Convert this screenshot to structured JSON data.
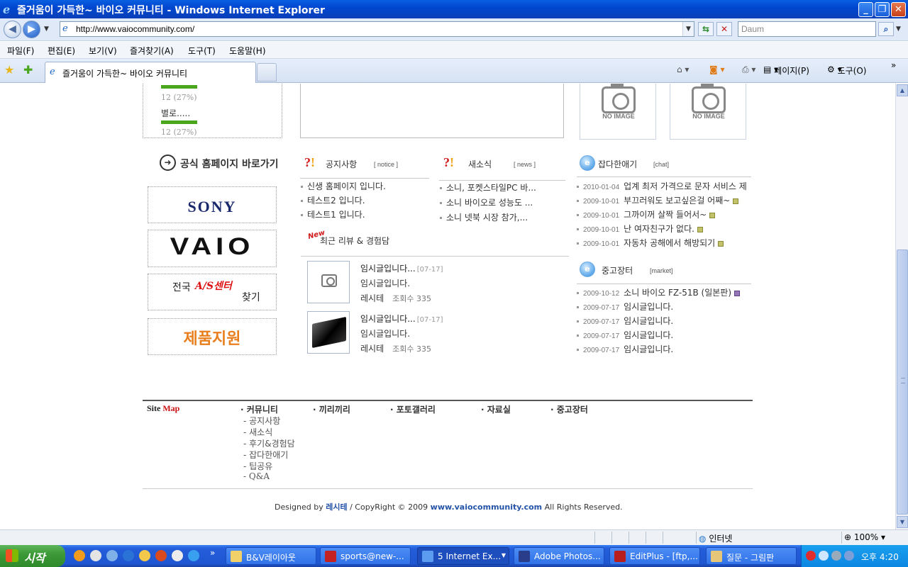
{
  "window": {
    "title": "즐거움이 가득한~ 바이오 커뮤니티 - Windows Internet Explorer",
    "minimize": "_",
    "restore": "❐",
    "close": "✕"
  },
  "address": {
    "url": "http://www.vaiocommunity.com/",
    "search_placeholder": "Daum"
  },
  "menu": [
    "파일(F)",
    "편집(E)",
    "보기(V)",
    "즐겨찾기(A)",
    "도구(T)",
    "도움말(H)"
  ],
  "tab": {
    "label": "즐거움이 가득한~ 바이오 커뮤니티"
  },
  "toolbar": {
    "page": "페이지(P)",
    "tools": "도구(O)",
    "more": "»"
  },
  "poll": {
    "pct_top": "12 (27%)",
    "label": "별로.....",
    "pct_bottom": "12 (27%)",
    "fill": 0.27
  },
  "no_image": "NO IMAGE",
  "official": {
    "title": "공식 홈페이지 바로가기",
    "sony": "SONY",
    "vaio": "VAIO",
    "as_prefix": "전국",
    "as_red": "A/S센터",
    "as_suffix": "찾기",
    "support": "제품지원"
  },
  "notice": {
    "title": "공지사항",
    "sub": "[ notice ]",
    "items": [
      "신생 홈페이지 입니다.",
      "테스트2 입니다.",
      "테스트1 입니다."
    ]
  },
  "news": {
    "title": "새소식",
    "sub": "[ news ]",
    "items": [
      "소니, 포켓스타일PC 바...",
      "소니 바이오로 성능도 ...",
      "소니 넷북 시장 참가,..."
    ]
  },
  "chat": {
    "title": "잡다한애기",
    "sub": "[chat]",
    "items": [
      {
        "date": "2010-01-04",
        "text": "업계 최저 가격으로 문자 서비스 제"
      },
      {
        "date": "2009-10-01",
        "text": "부끄러워도 보고싶은걸 어째~"
      },
      {
        "date": "2009-10-01",
        "text": "그까이꺼 살짝 들어서~"
      },
      {
        "date": "2009-10-01",
        "text": "난 여자친구가 없다."
      },
      {
        "date": "2009-10-01",
        "text": "자동차 공해에서 해방되기"
      }
    ]
  },
  "market": {
    "title": "중고장터",
    "sub": "[market]",
    "items": [
      {
        "date": "2009-10-12",
        "text": "소니 바이오 FZ-51B (일본판)"
      },
      {
        "date": "2009-07-17",
        "text": "임시글입니다."
      },
      {
        "date": "2009-07-17",
        "text": "임시글입니다."
      },
      {
        "date": "2009-07-17",
        "text": "임시글입니다."
      },
      {
        "date": "2009-07-17",
        "text": "임시글입니다."
      }
    ]
  },
  "reviews": {
    "new_mark": "New",
    "title": "최근 리뷰 & 경험담",
    "items": [
      {
        "title": "임시글입니다...",
        "date": "[07-17]",
        "body": "임시글입니다.",
        "author": "레시테",
        "views": "조회수 335"
      },
      {
        "title": "임시글입니다...",
        "date": "[07-17]",
        "body": "임시글입니다.",
        "author": "레시테",
        "views": "조회수 335"
      }
    ]
  },
  "sitemap": {
    "title_a": "Site",
    "title_b": "Map",
    "cats": [
      "· 커뮤니티",
      "· 끼리끼리",
      "· 포토갤러리",
      "· 자료실",
      "· 중고장터"
    ],
    "community_sub": [
      "- 공지사항",
      "- 새소식",
      "- 후기&경험담",
      "- 잡다한애기",
      "- 팁공유",
      "- Q&A"
    ]
  },
  "footer": {
    "designed": "Designed by",
    "designer": "레시테",
    "copy": "/ CopyRight © 2009",
    "site": "www.vaiocommunity.com",
    "rights": "All Rights Reserved."
  },
  "status": {
    "zone": "인터넷",
    "zoom": "100%"
  },
  "taskbar": {
    "start": "시작",
    "more": "»",
    "buttons": [
      "B&V레이아웃",
      "sports@new-...",
      "5 Internet Ex...",
      "Adobe Photos...",
      "EditPlus - [ftp,...",
      "질문 - 그림판"
    ],
    "clock": "오후 4:20"
  },
  "colors": {
    "accent": "#245edb",
    "poll_bar": "#4aa61c",
    "red": "#d01b1b",
    "orange": "#e97e1d"
  }
}
